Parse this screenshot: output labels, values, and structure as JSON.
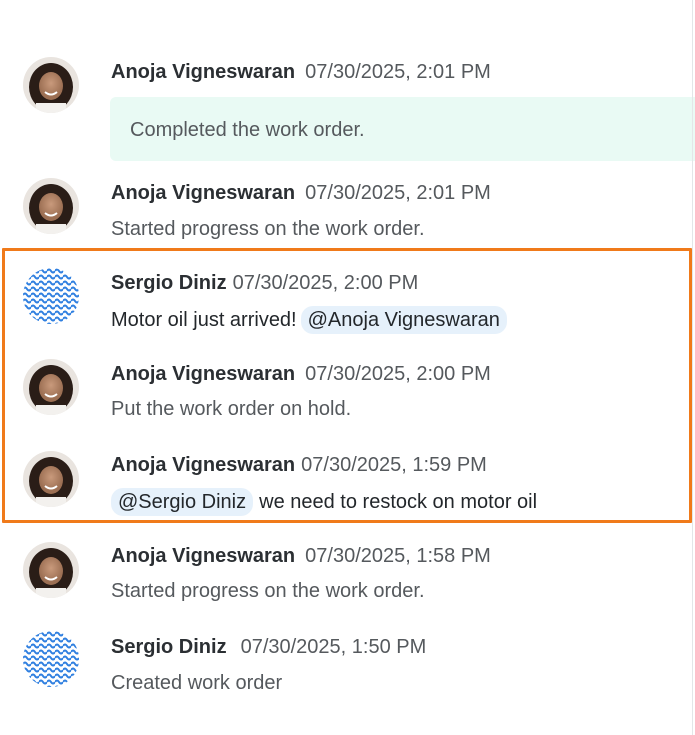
{
  "feed": {
    "entries": [
      {
        "author": "Anoja Vigneswaran",
        "timestamp": "07/30/2025, 2:01 PM",
        "text": "Completed the work order.",
        "avatar": "anoja-avatar"
      },
      {
        "author": "Anoja Vigneswaran",
        "timestamp": "07/30/2025, 2:01 PM",
        "text": "Started progress on the work order.",
        "avatar": "anoja-avatar"
      },
      {
        "author": "Sergio Diniz",
        "timestamp": "07/30/2025, 2:00 PM",
        "text": "Motor oil just arrived!",
        "mention": "@Anoja Vigneswaran",
        "avatar": "sergio-avatar"
      },
      {
        "author": "Anoja Vigneswaran",
        "timestamp": "07/30/2025, 2:00 PM",
        "text": "Put the work order on hold.",
        "avatar": "anoja-avatar"
      },
      {
        "author": "Anoja Vigneswaran",
        "timestamp": "07/30/2025, 1:59 PM",
        "mention": "@Sergio Diniz",
        "text": "we need to restock on motor oil",
        "avatar": "anoja-avatar"
      },
      {
        "author": "Anoja Vigneswaran",
        "timestamp": "07/30/2025, 1:58 PM",
        "text": "Started progress on the work order.",
        "avatar": "anoja-avatar"
      },
      {
        "author": "Sergio Diniz",
        "timestamp": "07/30/2025, 1:50 PM",
        "text": "Created work order",
        "avatar": "sergio-avatar"
      }
    ]
  },
  "colors": {
    "highlight_border": "#f07a1a",
    "completed_bg": "#e9faf4",
    "mention_bg": "#e6f1fb",
    "sergio_avatar_blue": "#2f7fe0"
  }
}
